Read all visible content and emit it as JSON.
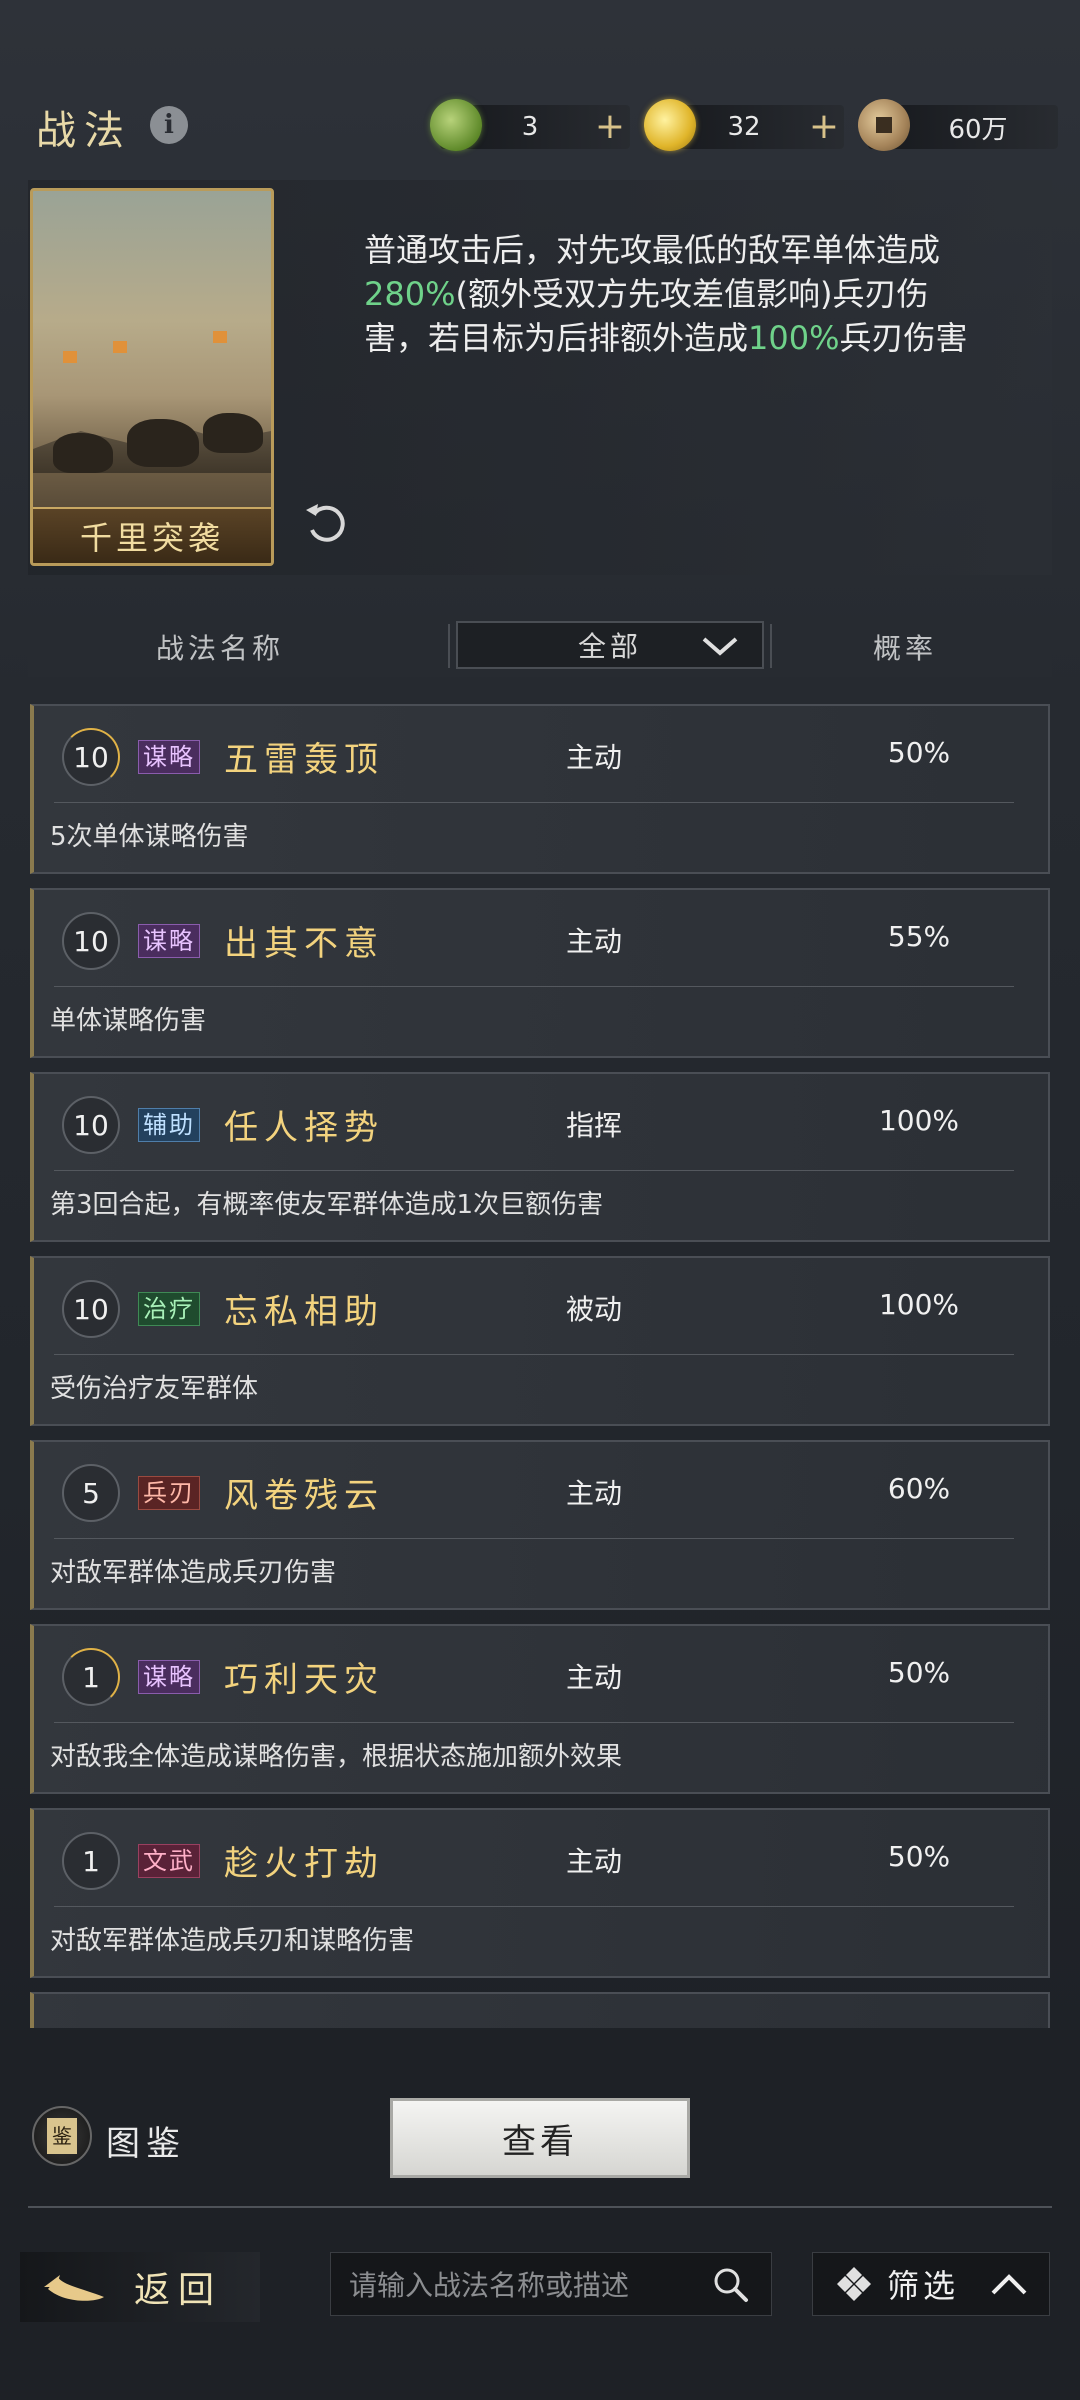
{
  "header": {
    "title": "战法",
    "resources": [
      {
        "icon": "jade-coin-icon",
        "value": "3"
      },
      {
        "icon": "gold-coin-icon",
        "value": "32"
      },
      {
        "icon": "copper-coin-icon",
        "value": "60万"
      }
    ],
    "plus": "+"
  },
  "detail": {
    "card_name": "千里突袭",
    "desc_1": "普通攻击后，对先攻最低的敌军单体造成",
    "desc_2": "280%",
    "desc_3": "(额外受双方先攻差值影响)兵刃伤害，若目标为后排额外造成",
    "desc_4": "100%",
    "desc_5": "兵刃伤害"
  },
  "columns": {
    "name": "战法名称",
    "filter_value": "全部",
    "prob": "概率"
  },
  "skills": [
    {
      "level": "10",
      "tag": "谋略",
      "tag_class": "mou",
      "name": "五雷轰顶",
      "type": "主动",
      "prob": "50%",
      "desc": "5次单体谋略伤害",
      "arc": true
    },
    {
      "level": "10",
      "tag": "谋略",
      "tag_class": "mou",
      "name": "出其不意",
      "type": "主动",
      "prob": "55%",
      "desc": "单体谋略伤害",
      "arc": false
    },
    {
      "level": "10",
      "tag": "辅助",
      "tag_class": "fu",
      "name": "任人择势",
      "type": "指挥",
      "prob": "100%",
      "desc": "第3回合起，有概率使友军群体造成1次巨额伤害",
      "arc": false
    },
    {
      "level": "10",
      "tag": "治疗",
      "tag_class": "zhi",
      "name": "忘私相助",
      "type": "被动",
      "prob": "100%",
      "desc": "受伤治疗友军群体",
      "arc": false
    },
    {
      "level": "5",
      "tag": "兵刃",
      "tag_class": "bing",
      "name": "风卷残云",
      "type": "主动",
      "prob": "60%",
      "desc": "对敌军群体造成兵刃伤害",
      "arc": false
    },
    {
      "level": "1",
      "tag": "谋略",
      "tag_class": "mou",
      "name": "巧利天灾",
      "type": "主动",
      "prob": "50%",
      "desc": "对敌我全体造成谋略伤害，根据状态施加额外效果",
      "arc": true
    },
    {
      "level": "1",
      "tag": "文武",
      "tag_class": "wen",
      "name": "趁火打劫",
      "type": "主动",
      "prob": "50%",
      "desc": "对敌军群体造成兵刃和谋略伤害",
      "arc": false
    }
  ],
  "bottom": {
    "book_label": "图鉴",
    "book_glyph": "鉴",
    "view_label": "查看",
    "back_label": "返回",
    "search_placeholder": "请输入战法名称或描述",
    "filter_label": "筛选"
  }
}
